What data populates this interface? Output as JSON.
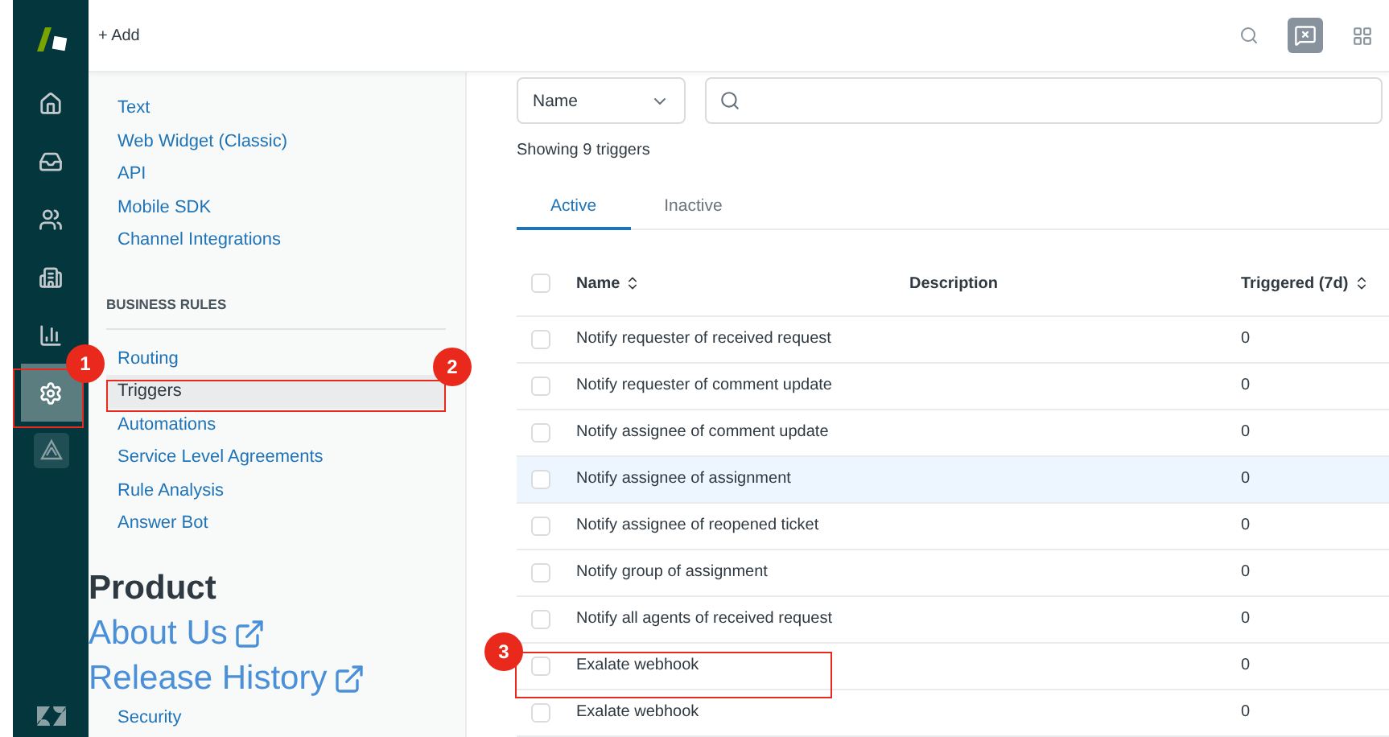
{
  "nav_rail": {
    "items": [
      {
        "kind": "home",
        "selected": false
      },
      {
        "kind": "views",
        "selected": false
      },
      {
        "kind": "customers",
        "selected": false
      },
      {
        "kind": "organizations",
        "selected": false
      },
      {
        "kind": "reporting",
        "selected": false
      },
      {
        "kind": "admin",
        "selected": true
      },
      {
        "kind": "app",
        "selected": false
      }
    ]
  },
  "top_bar": {
    "add_label": "+ Add"
  },
  "sidebar": {
    "sections": [
      {
        "items": [
          {
            "label": "Text",
            "selected": false
          },
          {
            "label": "Web Widget (Classic)",
            "selected": false
          },
          {
            "label": "API",
            "selected": false
          },
          {
            "label": "Mobile SDK",
            "selected": false
          },
          {
            "label": "Channel Integrations",
            "selected": false
          }
        ]
      },
      {
        "title": "BUSINESS RULES",
        "items": [
          {
            "label": "Routing",
            "selected": false
          },
          {
            "label": "Triggers",
            "selected": true
          },
          {
            "label": "Automations",
            "selected": false
          },
          {
            "label": "Service Level Agreements",
            "selected": false
          },
          {
            "label": "Rule Analysis",
            "selected": false
          },
          {
            "label": "Answer Bot",
            "selected": false
          }
        ]
      },
      {
        "items": [
          {
            "label": "Security",
            "selected": false
          }
        ]
      }
    ]
  },
  "filter": {
    "field": "Name"
  },
  "summary": "Showing 9 triggers",
  "tabs": [
    {
      "label": "Active",
      "selected": true
    },
    {
      "label": "Inactive",
      "selected": false
    }
  ],
  "table": {
    "select_all_checked": false,
    "columns": [
      {
        "label": "Name",
        "sortable": true
      },
      {
        "label": "Description",
        "sortable": false
      },
      {
        "label": "Triggered (7d)",
        "sortable": true
      }
    ],
    "rows": [
      {
        "name": "Notify requester of received request",
        "triggered": "0",
        "checked": false,
        "highlighted": false
      },
      {
        "name": "Notify requester of comment update",
        "triggered": "0",
        "checked": false,
        "highlighted": false
      },
      {
        "name": "Notify assignee of comment update",
        "triggered": "0",
        "checked": false,
        "highlighted": false
      },
      {
        "name": "Notify assignee of assignment",
        "triggered": "0",
        "checked": false,
        "highlighted": true
      },
      {
        "name": "Notify assignee of reopened ticket",
        "triggered": "0",
        "checked": false,
        "highlighted": false
      },
      {
        "name": "Notify group of assignment",
        "triggered": "0",
        "checked": false,
        "highlighted": false
      },
      {
        "name": "Notify all agents of received request",
        "triggered": "0",
        "checked": false,
        "highlighted": false
      },
      {
        "name": "Exalate webhook",
        "triggered": "0",
        "checked": false,
        "highlighted": false
      },
      {
        "name": "Exalate webhook",
        "triggered": "0",
        "checked": false,
        "highlighted": false
      }
    ]
  },
  "annotations": [
    {
      "number": "1"
    },
    {
      "number": "2"
    },
    {
      "number": "3"
    }
  ],
  "site_overlay": {
    "heading": "Product",
    "links": [
      {
        "label": "About Us"
      },
      {
        "label": "Release History"
      }
    ]
  }
}
